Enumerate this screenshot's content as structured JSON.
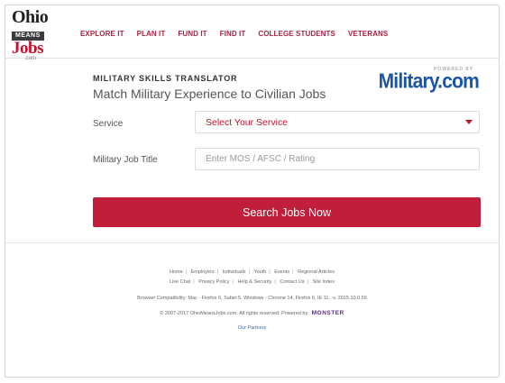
{
  "brand": {
    "ohio": "Ohio",
    "means": "MEANS",
    "jobs": "Jobs",
    "com": ".com"
  },
  "nav": {
    "items": [
      {
        "label": "EXPLORE IT"
      },
      {
        "label": "PLAN IT"
      },
      {
        "label": "FUND IT"
      },
      {
        "label": "FIND IT"
      },
      {
        "label": "COLLEGE STUDENTS"
      },
      {
        "label": "VETERANS"
      }
    ]
  },
  "translator": {
    "eyebrow": "MILITARY SKILLS TRANSLATOR",
    "headline": "Match Military Experience to Civilian Jobs",
    "powered_by": "POWERED BY",
    "partner_logo": "Military.com",
    "service_label": "Service",
    "service_value": "Select Your Service",
    "job_title_label": "Military Job Title",
    "job_title_placeholder": "Enter MOS / AFSC / Rating",
    "search_button": "Search Jobs Now"
  },
  "footer": {
    "links_row1": [
      "Home",
      "Employers",
      "Individuals",
      "Youth",
      "Events",
      "Regional Articles"
    ],
    "links_row2": [
      "Live Chat",
      "Privacy Policy",
      "Help & Security",
      "Contact Us",
      "Site Index"
    ],
    "compat": "Browser Compatibility: Mac - Firefox 6, Safari 5. Windows - Chrome 14, Firefox 6, IE 11. -v. 2015.10.0.59",
    "copyright": "© 2007-2017 OhioMeansJobs.com. All rights reserved. Powered by",
    "monster": "MONSTER",
    "partners": "Our Partners"
  },
  "colors": {
    "accent": "#c01e39",
    "nav_text": "#b31d3c",
    "partner_blue": "#1a56a8"
  }
}
